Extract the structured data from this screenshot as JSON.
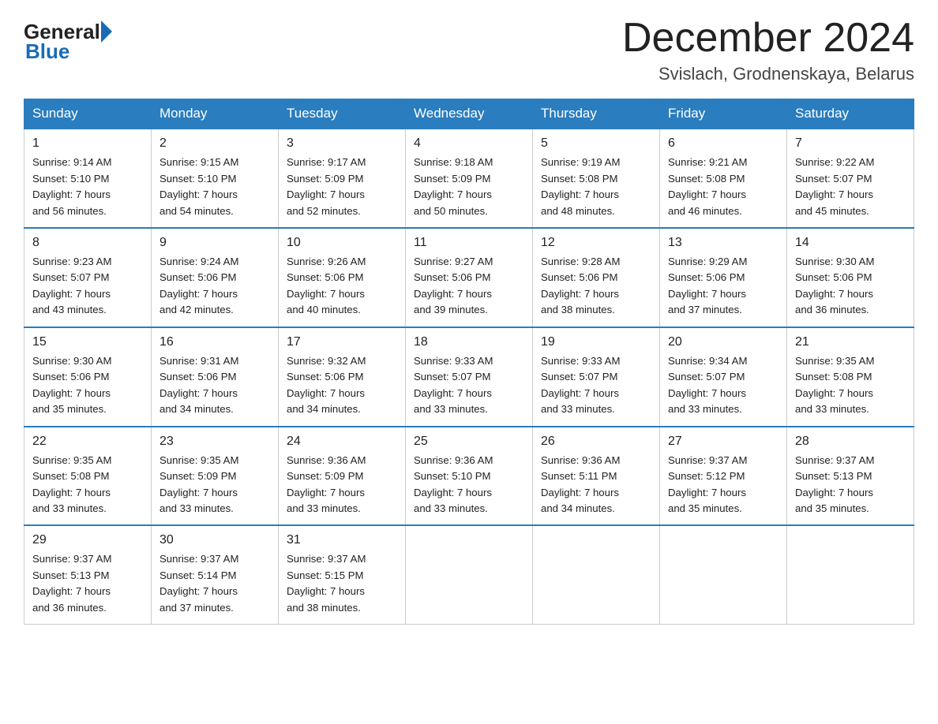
{
  "header": {
    "logo_general": "General",
    "logo_blue": "Blue",
    "month_title": "December 2024",
    "location": "Svislach, Grodnenskaya, Belarus"
  },
  "days_of_week": [
    "Sunday",
    "Monday",
    "Tuesday",
    "Wednesday",
    "Thursday",
    "Friday",
    "Saturday"
  ],
  "weeks": [
    [
      {
        "day": "1",
        "sunrise": "9:14 AM",
        "sunset": "5:10 PM",
        "daylight": "7 hours and 56 minutes."
      },
      {
        "day": "2",
        "sunrise": "9:15 AM",
        "sunset": "5:10 PM",
        "daylight": "7 hours and 54 minutes."
      },
      {
        "day": "3",
        "sunrise": "9:17 AM",
        "sunset": "5:09 PM",
        "daylight": "7 hours and 52 minutes."
      },
      {
        "day": "4",
        "sunrise": "9:18 AM",
        "sunset": "5:09 PM",
        "daylight": "7 hours and 50 minutes."
      },
      {
        "day": "5",
        "sunrise": "9:19 AM",
        "sunset": "5:08 PM",
        "daylight": "7 hours and 48 minutes."
      },
      {
        "day": "6",
        "sunrise": "9:21 AM",
        "sunset": "5:08 PM",
        "daylight": "7 hours and 46 minutes."
      },
      {
        "day": "7",
        "sunrise": "9:22 AM",
        "sunset": "5:07 PM",
        "daylight": "7 hours and 45 minutes."
      }
    ],
    [
      {
        "day": "8",
        "sunrise": "9:23 AM",
        "sunset": "5:07 PM",
        "daylight": "7 hours and 43 minutes."
      },
      {
        "day": "9",
        "sunrise": "9:24 AM",
        "sunset": "5:06 PM",
        "daylight": "7 hours and 42 minutes."
      },
      {
        "day": "10",
        "sunrise": "9:26 AM",
        "sunset": "5:06 PM",
        "daylight": "7 hours and 40 minutes."
      },
      {
        "day": "11",
        "sunrise": "9:27 AM",
        "sunset": "5:06 PM",
        "daylight": "7 hours and 39 minutes."
      },
      {
        "day": "12",
        "sunrise": "9:28 AM",
        "sunset": "5:06 PM",
        "daylight": "7 hours and 38 minutes."
      },
      {
        "day": "13",
        "sunrise": "9:29 AM",
        "sunset": "5:06 PM",
        "daylight": "7 hours and 37 minutes."
      },
      {
        "day": "14",
        "sunrise": "9:30 AM",
        "sunset": "5:06 PM",
        "daylight": "7 hours and 36 minutes."
      }
    ],
    [
      {
        "day": "15",
        "sunrise": "9:30 AM",
        "sunset": "5:06 PM",
        "daylight": "7 hours and 35 minutes."
      },
      {
        "day": "16",
        "sunrise": "9:31 AM",
        "sunset": "5:06 PM",
        "daylight": "7 hours and 34 minutes."
      },
      {
        "day": "17",
        "sunrise": "9:32 AM",
        "sunset": "5:06 PM",
        "daylight": "7 hours and 34 minutes."
      },
      {
        "day": "18",
        "sunrise": "9:33 AM",
        "sunset": "5:07 PM",
        "daylight": "7 hours and 33 minutes."
      },
      {
        "day": "19",
        "sunrise": "9:33 AM",
        "sunset": "5:07 PM",
        "daylight": "7 hours and 33 minutes."
      },
      {
        "day": "20",
        "sunrise": "9:34 AM",
        "sunset": "5:07 PM",
        "daylight": "7 hours and 33 minutes."
      },
      {
        "day": "21",
        "sunrise": "9:35 AM",
        "sunset": "5:08 PM",
        "daylight": "7 hours and 33 minutes."
      }
    ],
    [
      {
        "day": "22",
        "sunrise": "9:35 AM",
        "sunset": "5:08 PM",
        "daylight": "7 hours and 33 minutes."
      },
      {
        "day": "23",
        "sunrise": "9:35 AM",
        "sunset": "5:09 PM",
        "daylight": "7 hours and 33 minutes."
      },
      {
        "day": "24",
        "sunrise": "9:36 AM",
        "sunset": "5:09 PM",
        "daylight": "7 hours and 33 minutes."
      },
      {
        "day": "25",
        "sunrise": "9:36 AM",
        "sunset": "5:10 PM",
        "daylight": "7 hours and 33 minutes."
      },
      {
        "day": "26",
        "sunrise": "9:36 AM",
        "sunset": "5:11 PM",
        "daylight": "7 hours and 34 minutes."
      },
      {
        "day": "27",
        "sunrise": "9:37 AM",
        "sunset": "5:12 PM",
        "daylight": "7 hours and 35 minutes."
      },
      {
        "day": "28",
        "sunrise": "9:37 AM",
        "sunset": "5:13 PM",
        "daylight": "7 hours and 35 minutes."
      }
    ],
    [
      {
        "day": "29",
        "sunrise": "9:37 AM",
        "sunset": "5:13 PM",
        "daylight": "7 hours and 36 minutes."
      },
      {
        "day": "30",
        "sunrise": "9:37 AM",
        "sunset": "5:14 PM",
        "daylight": "7 hours and 37 minutes."
      },
      {
        "day": "31",
        "sunrise": "9:37 AM",
        "sunset": "5:15 PM",
        "daylight": "7 hours and 38 minutes."
      },
      null,
      null,
      null,
      null
    ]
  ],
  "labels": {
    "sunrise_prefix": "Sunrise: ",
    "sunset_prefix": "Sunset: ",
    "daylight_prefix": "Daylight: "
  }
}
